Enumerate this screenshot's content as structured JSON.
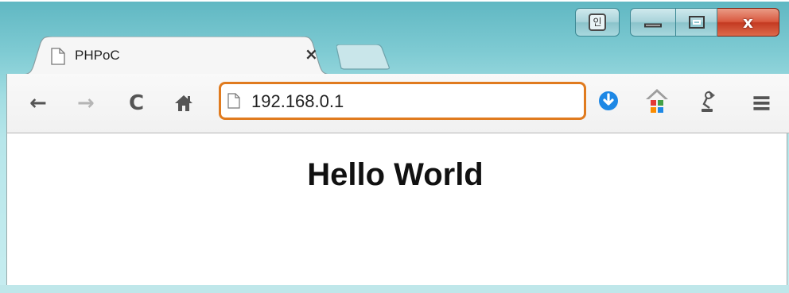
{
  "window": {
    "caption_buttons": {
      "ime": "인",
      "close": "x"
    },
    "colors": {
      "frame": "#8fd1d8",
      "close_button": "#d9593f",
      "address_highlight": "#e07b1f",
      "download_icon": "#1e88e5"
    }
  },
  "tab": {
    "title": "PHPoC",
    "close_label": "×"
  },
  "toolbar": {
    "back": "←",
    "forward": "→",
    "reload": "C",
    "home": "⌂",
    "menu": "≡",
    "icons": [
      "back-icon",
      "forward-icon",
      "reload-icon",
      "home-icon",
      "page-icon",
      "download-icon",
      "colorful-house-extension-icon",
      "lamp-extension-icon",
      "menu-icon"
    ]
  },
  "address_bar": {
    "value": "192.168.0.1"
  },
  "page": {
    "heading": "Hello World"
  }
}
